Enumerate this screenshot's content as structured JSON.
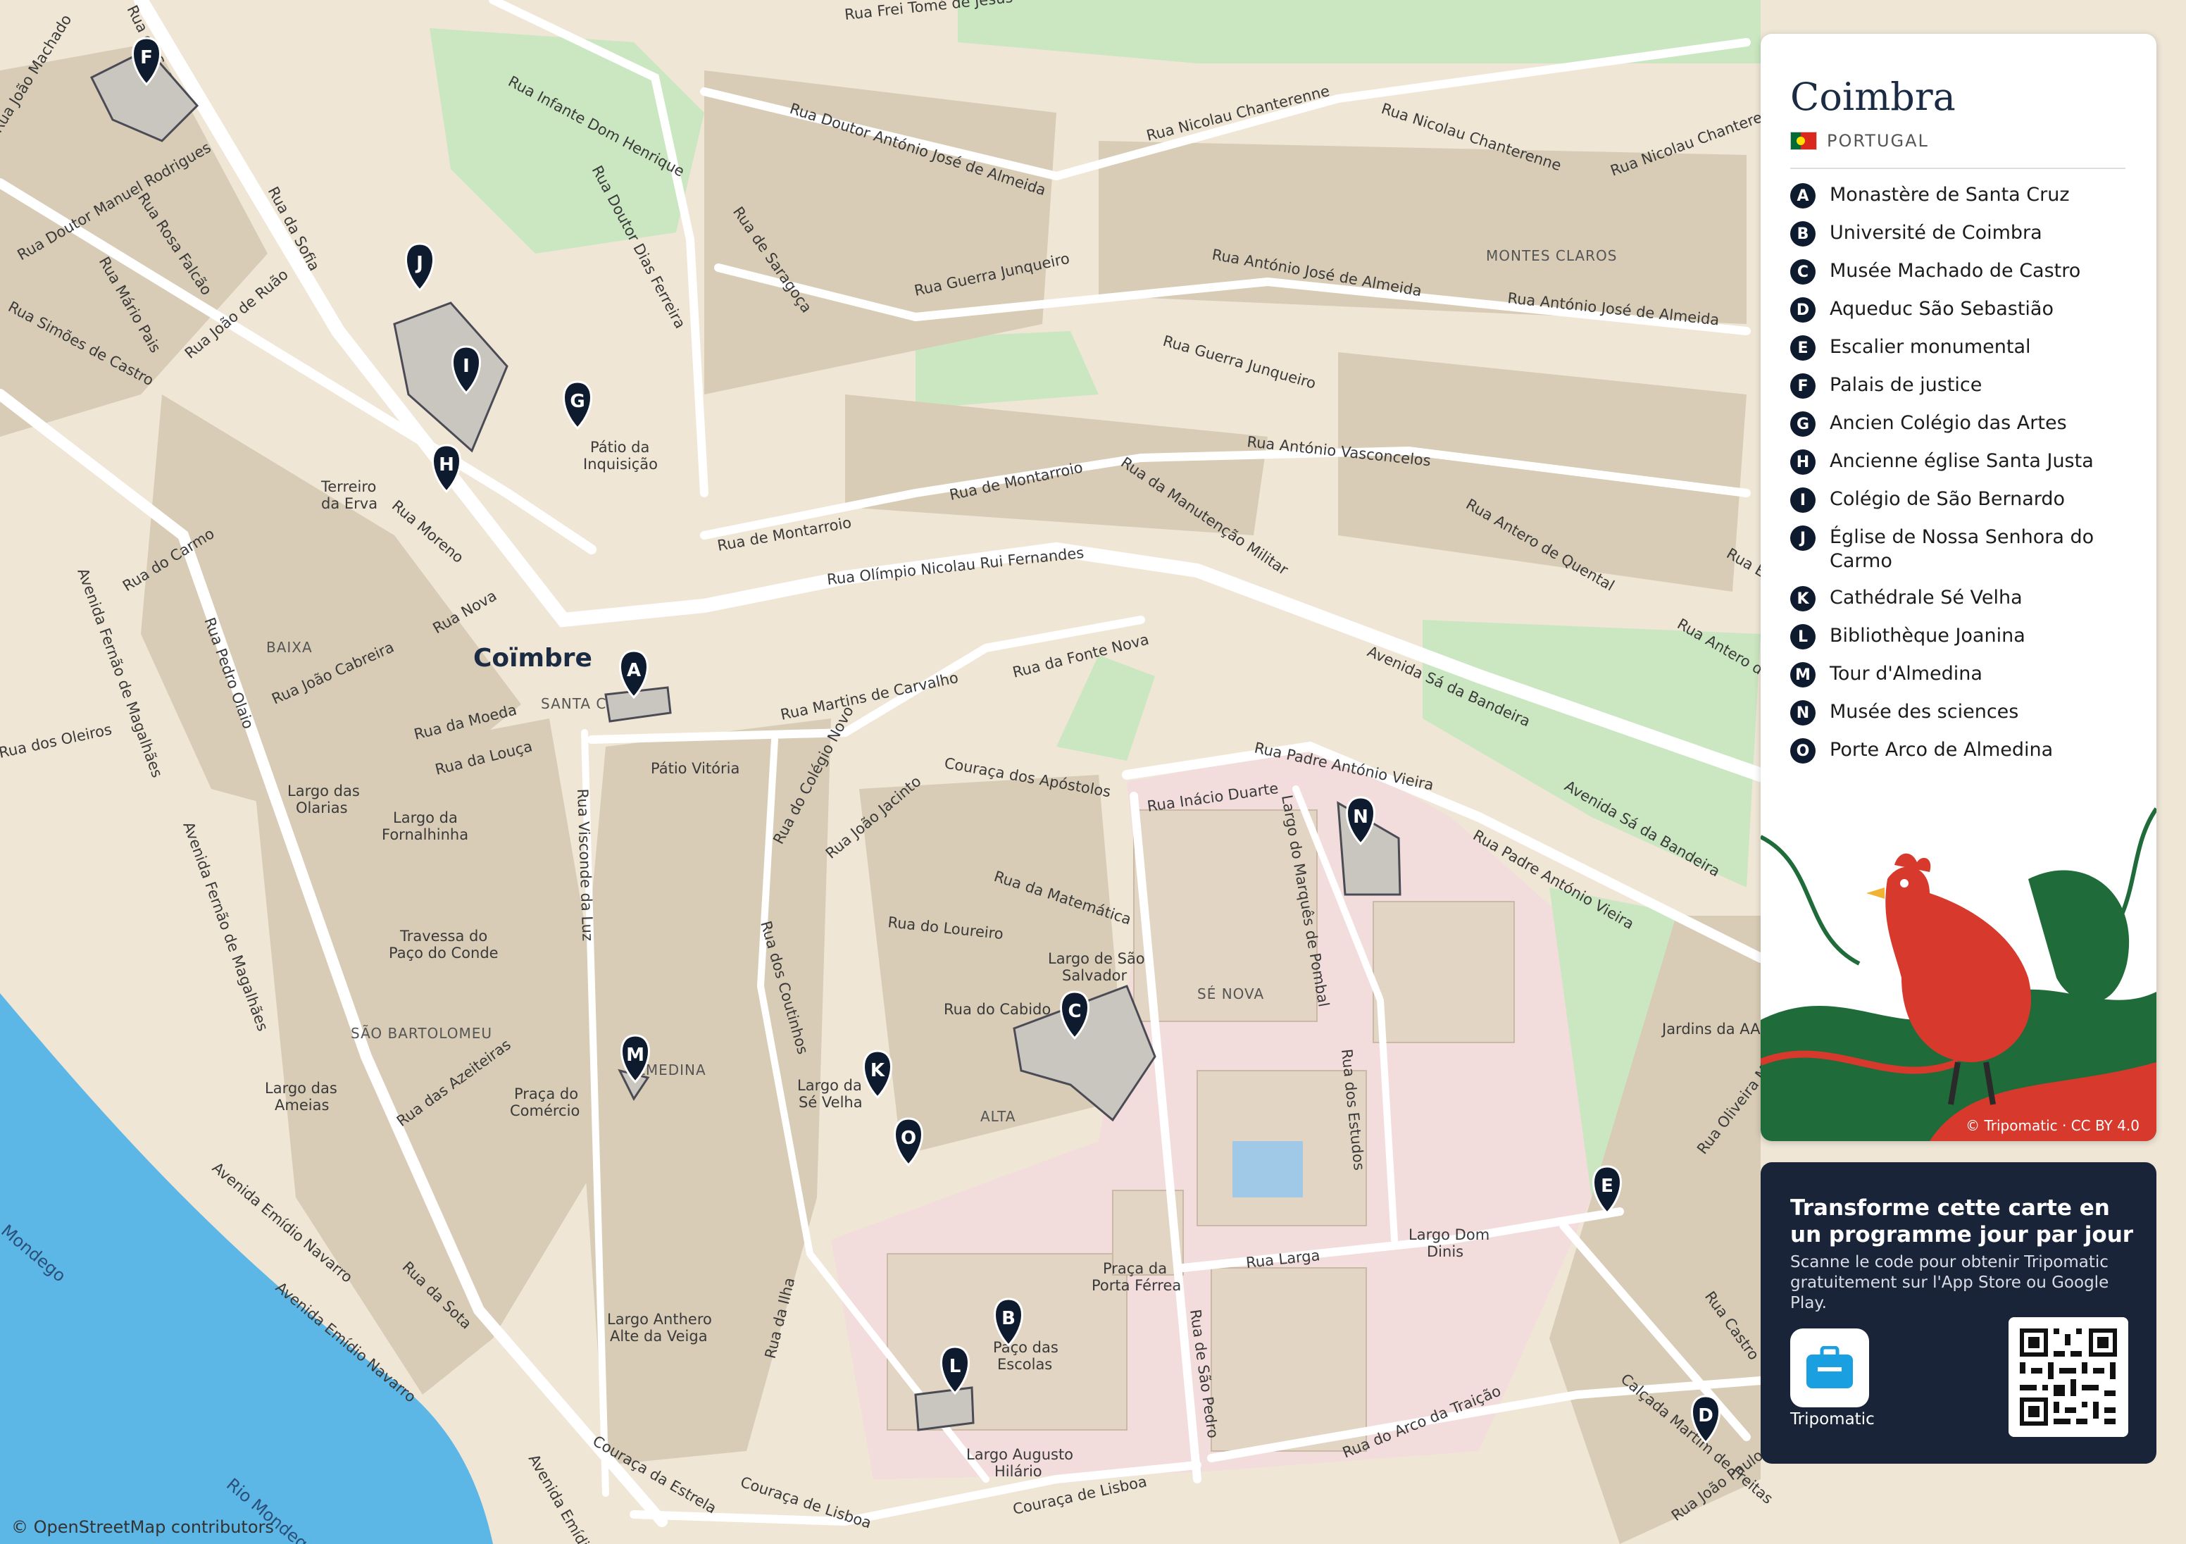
{
  "map": {
    "city_label": "Coïmbre",
    "attribution": "© OpenStreetMap contributors",
    "colors": {
      "water": "#5cb7e6",
      "park": "#c7e8bf",
      "block": "#d9cdb8",
      "street": "#ffffff",
      "university": "#f3d6d6",
      "pin": "#0e1a2e"
    },
    "streets": [
      "Rua Frei Tomé de Jesus",
      "Rua Infante Dom Henrique",
      "Rua Doutor Dias Ferreira",
      "Rua Doutor António José de Almeida",
      "Rua Nicolau Chanterenne",
      "Rua Nicolau Chanterenne",
      "Rua Nicolau Chanterenne",
      "Rua de Saragoça",
      "Rua António José de Almeida",
      "Rua António José de Almeida",
      "Rua Guerra Junqueiro",
      "Rua Guerra Junqueiro",
      "Rua António Vasconcelos",
      "Rua de Montarroio",
      "Rua de Montarroio",
      "Rua da Manutenção Militar",
      "Rua Olímpio Nicolau Rui Fernandes",
      "Rua Antero de Quental",
      "Rua Antero de Quental",
      "Avenida Sá da Bandeira",
      "Avenida Sá da Bandeira",
      "Rua da Fonte Nova",
      "Rua Martins de Carvalho",
      "Rua Padre António Vieira",
      "Rua Padre António Vieira",
      "Couraça dos Apóstolos",
      "Rua Inácio Duarte",
      "Largo do Marquês de Pombal",
      "Rua do Colégio Novo",
      "Rua João Jacinto",
      "Rua da Matemática",
      "Rua do Loureiro",
      "Rua dos Estudos",
      "Rua do Cabido",
      "Rua dos Coutinhos",
      "Rua Visconde da Luz",
      "Rua da Sofia",
      "Rua da Sofia",
      "Rua João Machado",
      "Rua Doutor Manuel Rodrigues",
      "Rua Rosa Falcão",
      "Rua Mário Pais",
      "Rua João de Ruão",
      "Rua Simões de Castro",
      "Rua do Carmo",
      "Rua Moreno",
      "Rua Nova",
      "Rua Pedro Olaio",
      "Rua João Cabreira",
      "Rua da Moeda",
      "Rua da Louça",
      "Rua dos Oleiros",
      "Avenida Fernão de Magalhães",
      "Avenida Fernão de Magalhães",
      "Rua das Azeiteiras",
      "Avenida Emídio Navarro",
      "Avenida Emídio Navarro",
      "Avenida Emídio Navarro",
      "Rua da Sota",
      "Rua da Ilha",
      "Couraça da Estrela",
      "Couraça de Lisboa",
      "Couraça de Lisboa",
      "Rua Larga",
      "Rua de São Pedro",
      "Rua do Arco da Traição",
      "Calçada Martim de Freitas",
      "Rua Castro",
      "Rua Oliveira M",
      "Rua João Paulo II",
      "Rua Eça"
    ],
    "places": [
      "Pátio da",
      "Inquisição",
      "Terreiro",
      "da Erva",
      "Pátio Vitória",
      "Largo das",
      "Olarias",
      "Largo da",
      "Fornalhinha",
      "Travessa do",
      "Paço do Conde",
      "Largo das",
      "Ameias",
      "Praça do",
      "Comércio",
      "Largo de São",
      "Salvador",
      "Largo da",
      "Sé Velha",
      "Praça da",
      "Porta Férrea",
      "Paço das",
      "Escolas",
      "Largo Anthero",
      "Alte da Veiga",
      "Largo Augusto",
      "Hilário",
      "Largo Dom",
      "Dinis",
      "Jardins da AAC"
    ],
    "districts": [
      "MONTES CLAROS",
      "BAIXA",
      "SANTA CRUZ",
      "SÉ NOVA",
      "ALTA",
      "SÃO BARTOLOMEU",
      "ALMEDINA"
    ],
    "rivers": [
      "Mondego",
      "Rio Mondego"
    ],
    "pins": [
      "A",
      "B",
      "C",
      "D",
      "E",
      "F",
      "G",
      "H",
      "I",
      "J",
      "K",
      "L",
      "M",
      "N",
      "O"
    ]
  },
  "legend": {
    "title": "Coimbra",
    "country": "PORTUGAL",
    "items": [
      {
        "letter": "A",
        "name": "Monastère de Santa Cruz"
      },
      {
        "letter": "B",
        "name": "Université de Coimbra"
      },
      {
        "letter": "C",
        "name": "Musée Machado de Castro"
      },
      {
        "letter": "D",
        "name": "Aqueduc São Sebastião"
      },
      {
        "letter": "E",
        "name": "Escalier monumental"
      },
      {
        "letter": "F",
        "name": "Palais de justice"
      },
      {
        "letter": "G",
        "name": "Ancien Colégio das Artes"
      },
      {
        "letter": "H",
        "name": "Ancienne église Santa Justa"
      },
      {
        "letter": "I",
        "name": "Colégio de São Bernardo"
      },
      {
        "letter": "J",
        "name": "Église de Nossa Senhora do Carmo"
      },
      {
        "letter": "K",
        "name": "Cathédrale Sé Velha"
      },
      {
        "letter": "L",
        "name": "Bibliothèque Joanina"
      },
      {
        "letter": "M",
        "name": "Tour d'Almedina"
      },
      {
        "letter": "N",
        "name": "Musée des sciences"
      },
      {
        "letter": "O",
        "name": "Porte Arco de Almedina"
      }
    ],
    "art_credit": "© Tripomatic · CC BY 4.0"
  },
  "promo": {
    "title": "Transforme cette carte en un programme jour par jour",
    "description": "Scanne le code pour obtenir Tripomatic gratuitement sur l'App Store ou Google Play.",
    "app_name": "Tripomatic"
  }
}
